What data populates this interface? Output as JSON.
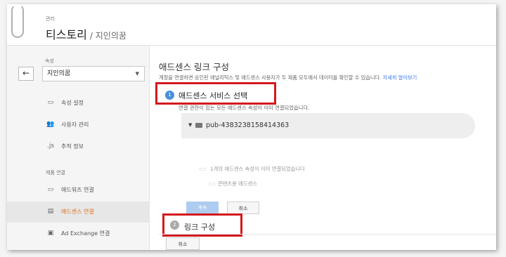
{
  "header": {
    "breadcrumb": "관리",
    "title": "티스토리",
    "subtitle": "/ 지인의꿈"
  },
  "sidebar": {
    "back_icon": "←",
    "property_label": "속성",
    "property_value": "지인의꿈",
    "property_caret": "▼",
    "items": [
      {
        "label": "속성 설정",
        "icon": "▭"
      },
      {
        "label": "사용자 관리",
        "icon": "👥"
      },
      {
        "label": "추적 정보",
        "icon": ".js"
      }
    ],
    "section_label": "제품 연결",
    "link_items": [
      {
        "label": "애드워즈 연결",
        "icon": "▭"
      },
      {
        "label": "애드센스 연결",
        "icon": "▤"
      },
      {
        "label": "Ad Exchange 연결",
        "icon": "▣"
      }
    ]
  },
  "main": {
    "title": "애드센스 링크 구성",
    "description": "계정을 연결하면 승인된 애널리틱스 및 애드센스 사용자가 두 제품 모두에서 데이터를 확인할 수 있습니다.",
    "learn_more": "자세히 알아보기",
    "step1": {
      "number": "1",
      "label": "애드센스 서비스 선택",
      "info": "연결 권한이 있는 모든 애드센스 속성이 이미 연결되었습니다.",
      "publisher_id": "pub-4383238158414363"
    },
    "linked_note": "1개의 애드센스 속성이 이미 연결되었습니다",
    "content_note": "콘텐츠용 애드센스",
    "chain_icon": "⊂⊃",
    "continue_button": "계속",
    "cancel_button": "취소",
    "step2": {
      "number": "2",
      "label": "링크 구성"
    },
    "bottom_cancel": "취소"
  },
  "colors": {
    "highlight": "#d4181e",
    "accent": "#e06c1a",
    "link": "#3b78e7"
  }
}
